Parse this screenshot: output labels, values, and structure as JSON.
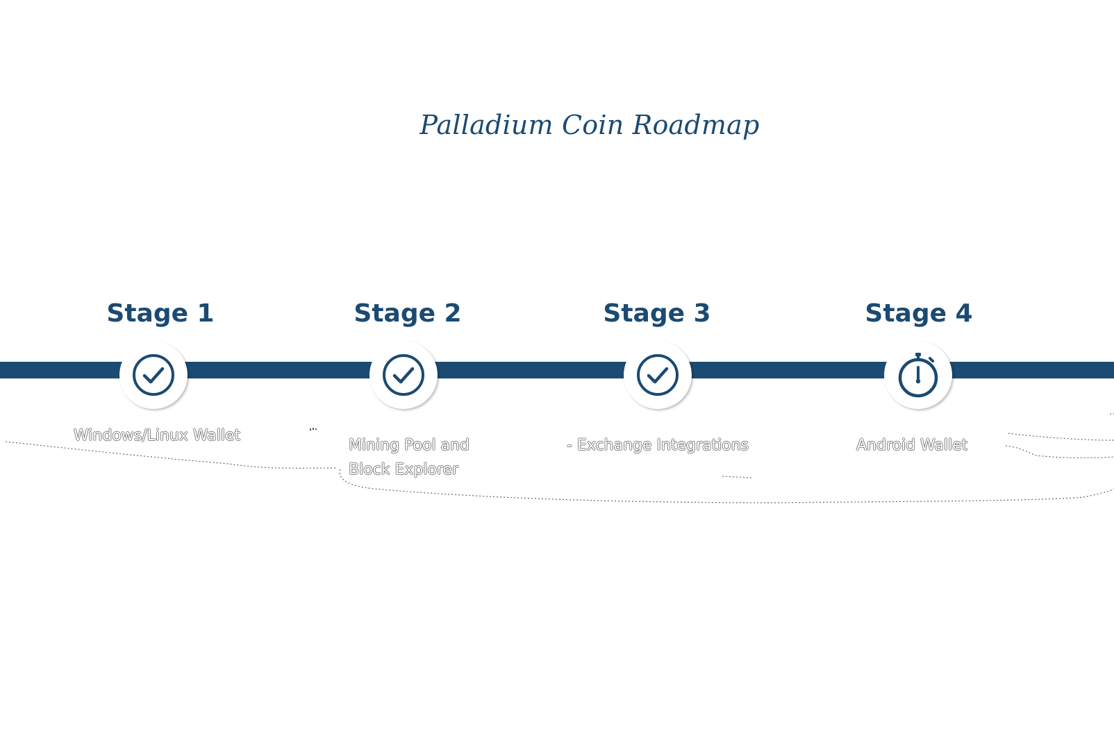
{
  "title": "Palladium Coin Roadmap",
  "colors": {
    "accent": "#1b4a72",
    "node_fill": "#ffffff",
    "description_text": "#ffffff"
  },
  "stages": [
    {
      "label": "Stage 1",
      "status": "completed",
      "icon": "check-circle-icon",
      "description_lines": [
        "Windows/Linux Wallet"
      ]
    },
    {
      "label": "Stage 2",
      "status": "completed",
      "icon": "check-circle-icon",
      "description_lines": [
        "Mining Pool and",
        "Block Explorer"
      ]
    },
    {
      "label": "Stage 3",
      "status": "completed",
      "icon": "check-circle-icon",
      "description_lines": [
        "- Exchange Integrations"
      ]
    },
    {
      "label": "Stage 4",
      "status": "in-progress",
      "icon": "stopwatch-icon",
      "description_lines": [
        "Android Wallet"
      ]
    }
  ]
}
